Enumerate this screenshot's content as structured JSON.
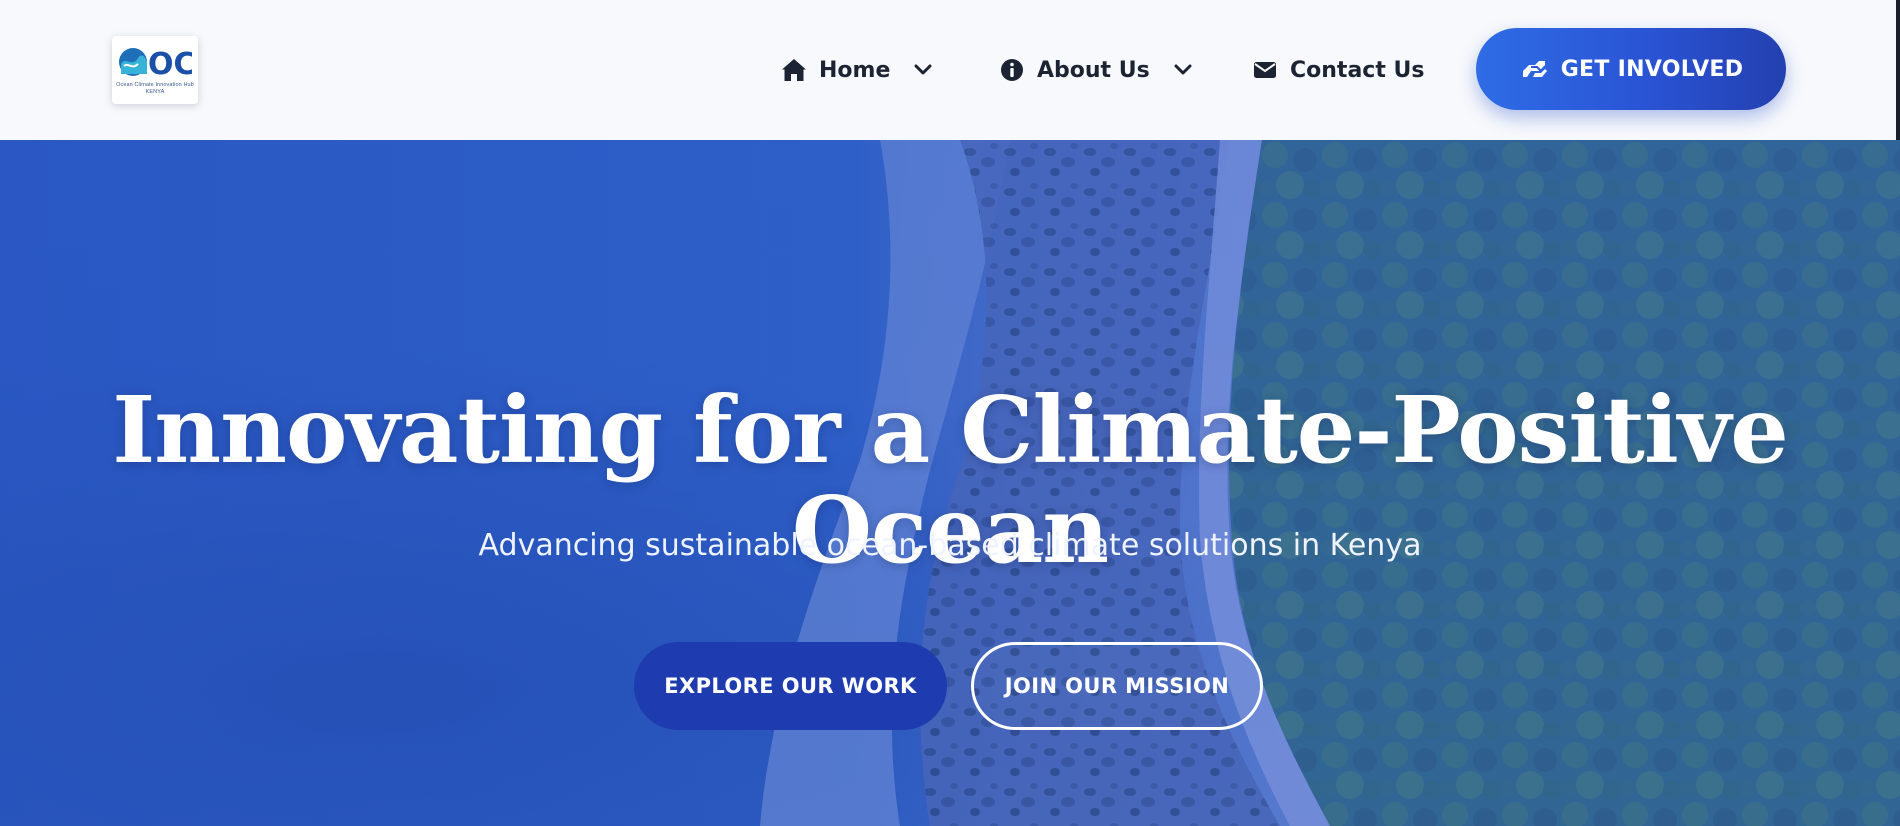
{
  "header": {
    "logo": {
      "wordmark": "OCI",
      "tagline_line1": "Ocean Climate Innovation Hub",
      "tagline_line2": "KENYA"
    },
    "nav": [
      {
        "label": "Home",
        "icon": "home-icon",
        "has_dropdown": true
      },
      {
        "label": "About Us",
        "icon": "info-icon",
        "has_dropdown": true
      },
      {
        "label": "Contact Us",
        "icon": "envelope-icon",
        "has_dropdown": false
      }
    ],
    "cta": {
      "label": "GET INVOLVED",
      "icon": "hands-helping-icon"
    }
  },
  "hero": {
    "title": "Innovating for a Climate-Positive Ocean",
    "subtitle": "Advancing sustainable ocean-based climate solutions in Kenya",
    "primary_button": "EXPLORE OUR WORK",
    "secondary_button": "JOIN OUR MISSION"
  },
  "colors": {
    "header_bg": "#f7f9fc",
    "nav_text": "#1c2333",
    "accent_blue": "#2a54d4",
    "primary_button_bg": "#1e3caf",
    "ocean_blue": "#2d5fc0",
    "forest_green": "#2f6a55"
  }
}
